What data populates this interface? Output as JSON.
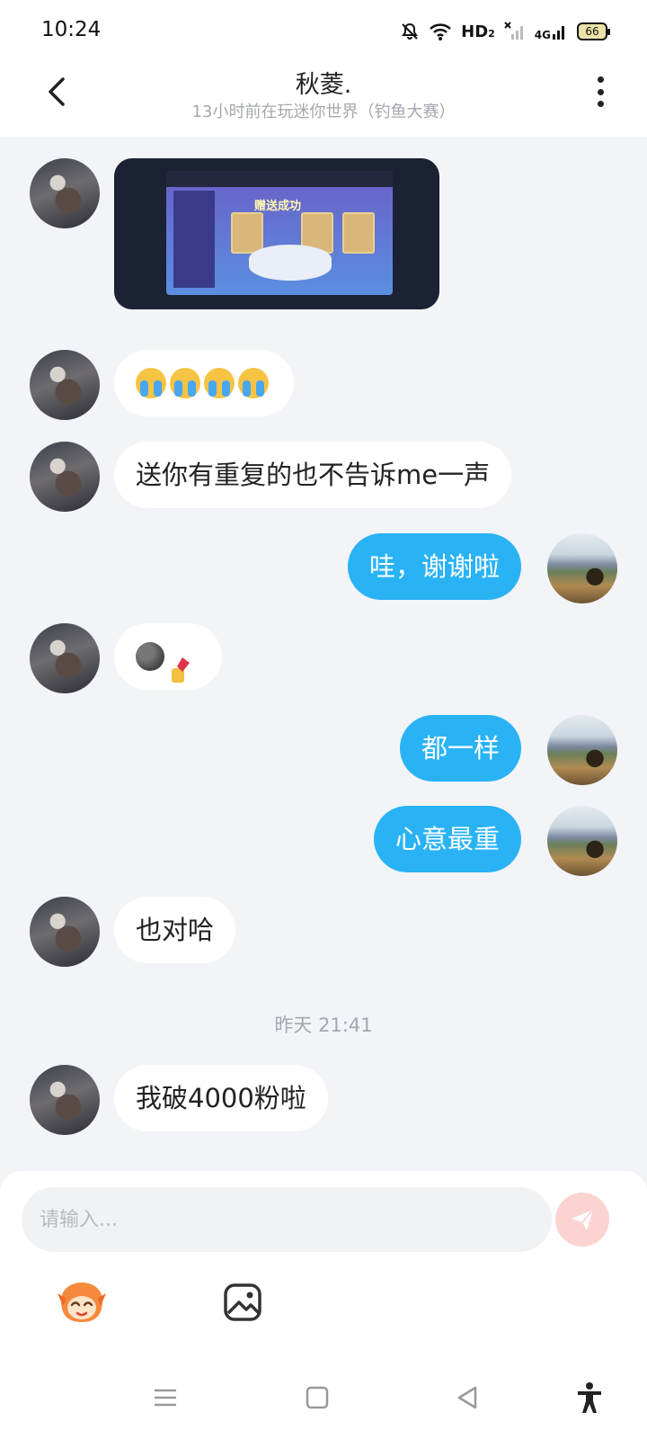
{
  "status_bar": {
    "time": "10:24",
    "network_label": "HD",
    "network_sub": "2",
    "cell_label": "4G",
    "battery": "66",
    "icons": [
      "mute-bell-icon",
      "wifi-icon",
      "signal-x-icon",
      "signal-icon",
      "battery-icon"
    ]
  },
  "header": {
    "title": "秋菱.",
    "subtitle": "13小时前在玩迷你世界（钓鱼大赛）",
    "back_icon": "chevron-left-icon",
    "more_icon": "more-vertical-icon"
  },
  "messages": [
    {
      "side": "left",
      "type": "image",
      "image_desc": "game-screenshot",
      "game_text": "赠送成功"
    },
    {
      "side": "left",
      "type": "emoji",
      "emojis": [
        "loudly-crying-face",
        "loudly-crying-face",
        "loudly-crying-face",
        "loudly-crying-face"
      ]
    },
    {
      "side": "left",
      "type": "text",
      "text": "送你有重复的也不告诉me一声"
    },
    {
      "side": "right",
      "type": "text",
      "text": "哇，谢谢啦"
    },
    {
      "side": "left",
      "type": "emoji",
      "emojis": [
        "new-moon-face",
        "nail-polish"
      ]
    },
    {
      "side": "right",
      "type": "text",
      "text": "都一样"
    },
    {
      "side": "right",
      "type": "text",
      "text": "心意最重"
    },
    {
      "side": "left",
      "type": "text",
      "text": "也对哈"
    },
    {
      "side": "left",
      "type": "text",
      "text": "我破4000粉啦"
    }
  ],
  "timestamp": "昨天 21:41",
  "composer": {
    "placeholder": "请输入...",
    "send_icon": "send-plane-icon",
    "sticker_icon": "mascot-sticker-icon",
    "image_icon": "image-picker-icon"
  },
  "nav_bar": {
    "icons": [
      "menu-icon",
      "home-square-icon",
      "back-triangle-icon",
      "accessibility-icon"
    ]
  },
  "colors": {
    "accent_bubble": "#29b3f5",
    "background": "#f3f4f8",
    "send_button": "#fbd4d2"
  }
}
